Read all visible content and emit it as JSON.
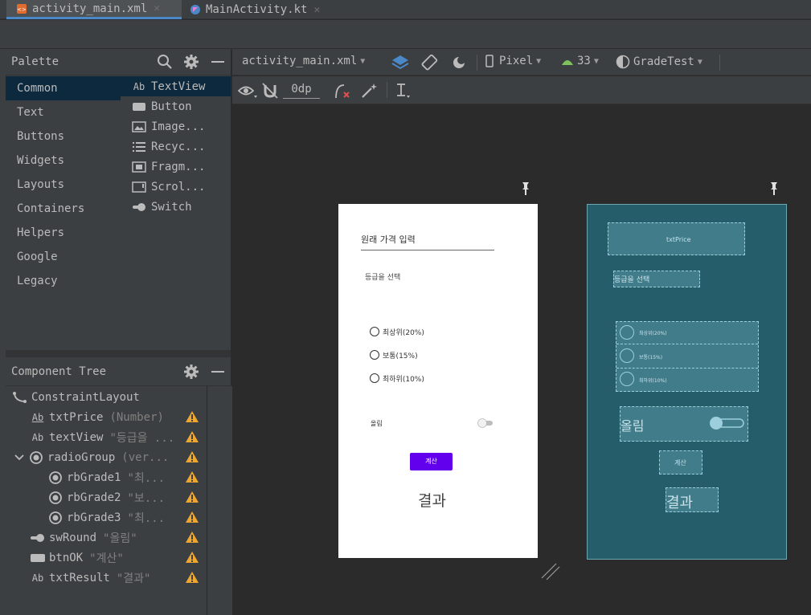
{
  "tabs": [
    {
      "label": "activity_main.xml",
      "active": true
    },
    {
      "label": "MainActivity.kt",
      "active": false
    }
  ],
  "palette": {
    "title": "Palette",
    "categories": [
      "Common",
      "Text",
      "Buttons",
      "Widgets",
      "Layouts",
      "Containers",
      "Helpers",
      "Google",
      "Legacy"
    ],
    "widgets": [
      {
        "icon": "Ab",
        "label": "TextView"
      },
      {
        "icon": "button-icon",
        "label": "Button"
      },
      {
        "icon": "image-icon",
        "label": "Image..."
      },
      {
        "icon": "list-icon",
        "label": "Recyc..."
      },
      {
        "icon": "fragment-icon",
        "label": "Fragm..."
      },
      {
        "icon": "scroll-icon",
        "label": "Scrol..."
      },
      {
        "icon": "switch-icon",
        "label": "Switch"
      }
    ]
  },
  "tree": {
    "title": "Component Tree",
    "rows": [
      {
        "name": "ConstraintLayout",
        "desc": ""
      },
      {
        "name": "txtPrice",
        "desc": "(Number)"
      },
      {
        "name": "textView",
        "desc": "\"등급을 ..."
      },
      {
        "name": "radioGroup",
        "desc": "(ver..."
      },
      {
        "name": "rbGrade1",
        "desc": "\"최..."
      },
      {
        "name": "rbGrade2",
        "desc": "\"보..."
      },
      {
        "name": "rbGrade3",
        "desc": "\"최..."
      },
      {
        "name": "swRound",
        "desc": "\"올림\""
      },
      {
        "name": "btnOK",
        "desc": "\"계산\""
      },
      {
        "name": "txtResult",
        "desc": "\"결과\""
      }
    ]
  },
  "toolbar": {
    "file": "activity_main.xml",
    "device": "Pixel",
    "api": "33",
    "theme": "GradeTest",
    "margin": "0dp"
  },
  "phone": {
    "price_hint": "원래 가격 입력",
    "grade_label": "등급을 선택",
    "rb1": "최상위(20%)",
    "rb2": "보통(15%)",
    "rb3": "최하위(10%)",
    "switch_label": "올림",
    "button": "계산",
    "result": "결과"
  },
  "blueprint": {
    "price": "txtPrice",
    "grade_label": "등급을 선택",
    "rb1": "최상위(20%)",
    "rb2": "보통(15%)",
    "rb3": "최하위(10%)",
    "switch_label": "올림",
    "button": "계산",
    "result": "결과"
  },
  "colors": {
    "accent": "#4a88c7",
    "selection": "#0d293e",
    "warning": "#f0a732",
    "button": "#6200ee",
    "blueprint": "#255d6b"
  }
}
